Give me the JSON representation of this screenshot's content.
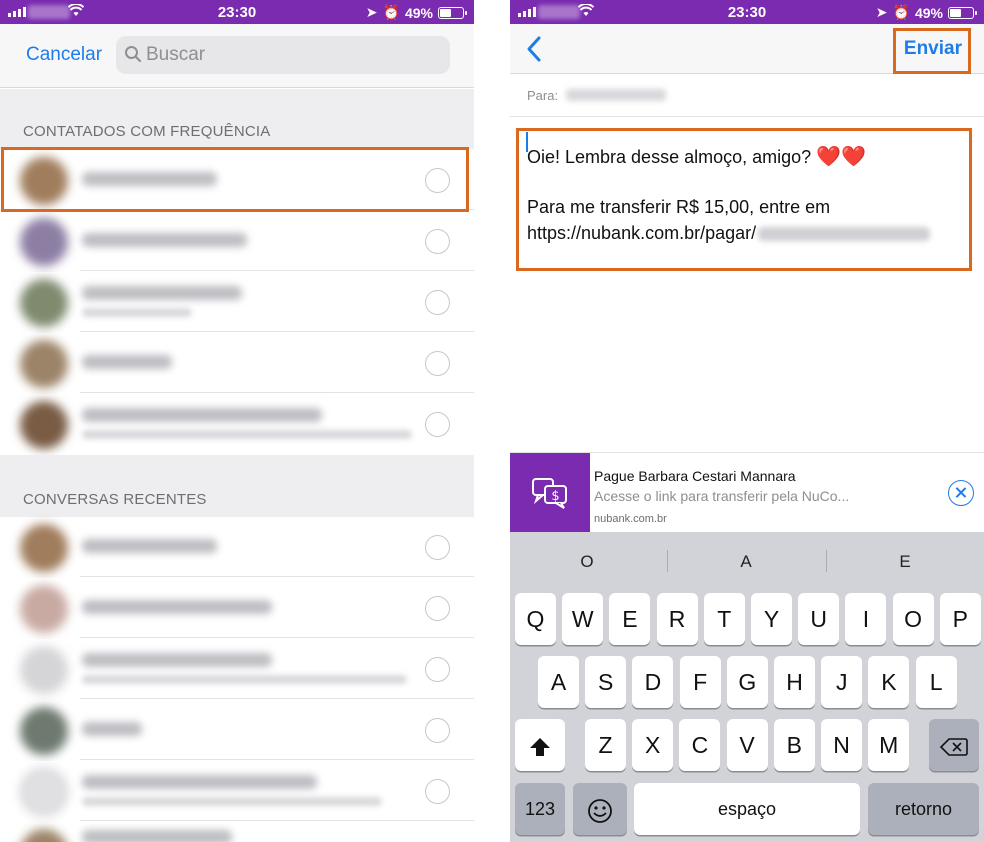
{
  "left": {
    "status": {
      "time": "23:30",
      "battery": "49%",
      "battery_level": 0.49
    },
    "cancel_label": "Cancelar",
    "search_placeholder": "Buscar",
    "frequent_header": "CONTATADOS COM FREQUÊNCIA",
    "recent_header": "CONVERSAS RECENTES"
  },
  "right": {
    "status": {
      "time": "23:30",
      "battery": "49%",
      "battery_level": 0.49
    },
    "send_label": "Enviar",
    "to_label": "Para:",
    "message": {
      "line1": "Oie! Lembra desse almoço, amigo?",
      "hearts": "❤️❤️",
      "line2": "Para me transferir R$ 15,00, entre em",
      "line3": "https://nubank.com.br/pagar/"
    },
    "suggestion": {
      "title": "Pague Barbara Cestari Mannara",
      "description": "Acesse o link para transferir pela NuCo...",
      "domain": "nubank.com.br"
    },
    "keyboard": {
      "predictions": [
        "O",
        "A",
        "E"
      ],
      "row1": [
        "Q",
        "W",
        "E",
        "R",
        "T",
        "Y",
        "U",
        "I",
        "O",
        "P"
      ],
      "row2": [
        "A",
        "S",
        "D",
        "F",
        "G",
        "H",
        "J",
        "K",
        "L"
      ],
      "row3": [
        "Z",
        "X",
        "C",
        "V",
        "B",
        "N",
        "M"
      ],
      "numbers_key": "123",
      "space_key": "espaço",
      "return_key": "retorno"
    }
  },
  "colors": {
    "accent": "#1e7ce8",
    "highlight": "#d9691e",
    "nubank_purple": "#7a2bb0"
  }
}
